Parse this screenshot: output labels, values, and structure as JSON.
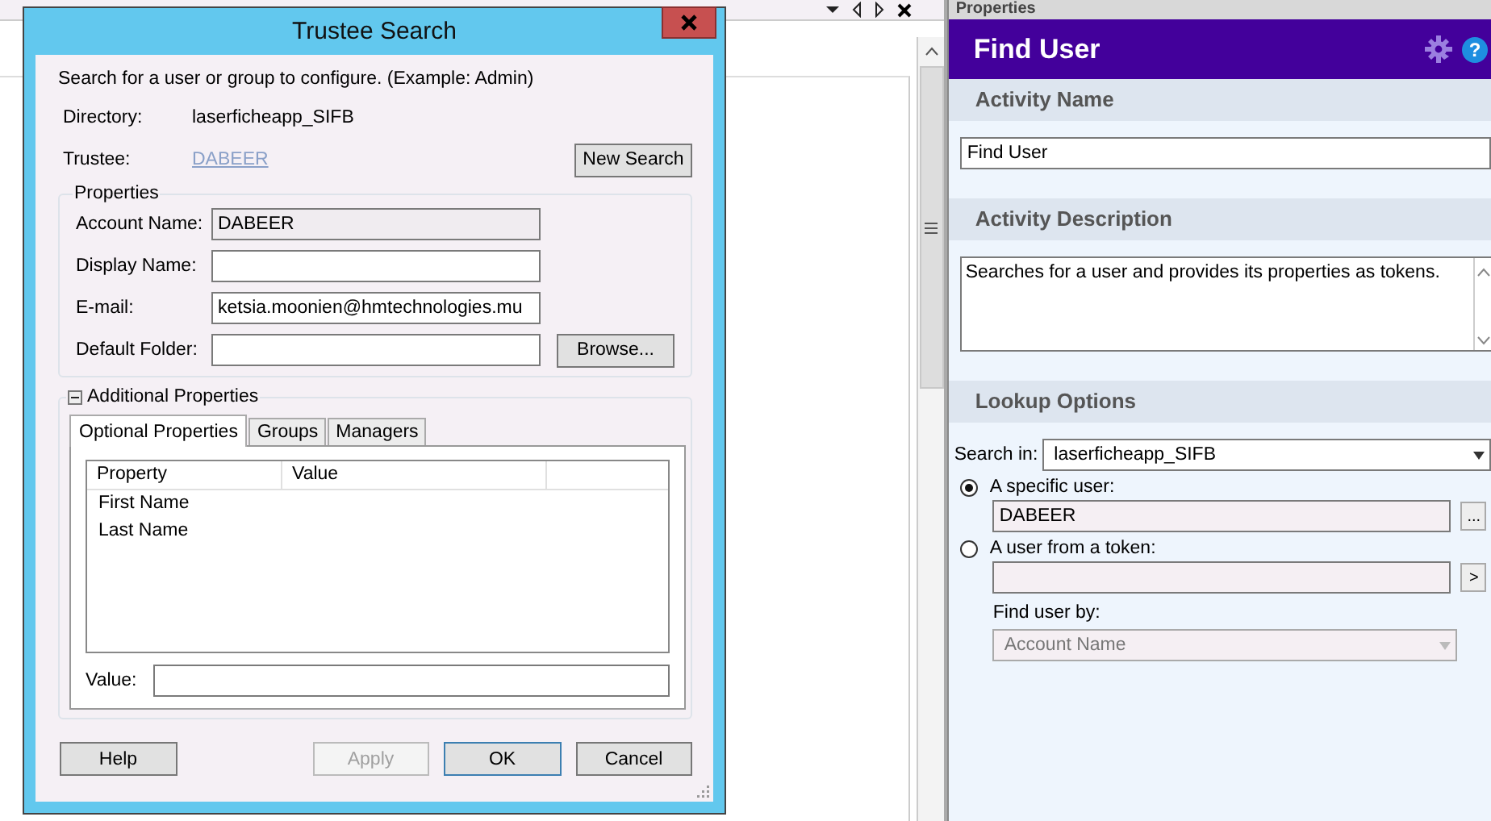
{
  "background": {
    "panel_title": "Properties"
  },
  "dialog": {
    "title": "Trustee Search",
    "instructions": "Search for a user or group to configure. (Example: Admin)",
    "directory": {
      "label": "Directory:",
      "value": "laserficheapp_SIFB"
    },
    "trustee": {
      "label": "Trustee:",
      "value": "DABEER"
    },
    "new_search_button": "New Search",
    "properties": {
      "title": "Properties",
      "fields": [
        {
          "label": "Account Name:",
          "value": "DABEER",
          "readonly": true
        },
        {
          "label": "Display Name:",
          "readonly": false
        },
        {
          "label": "E-mail:",
          "value": "ketsia.moonien@hmtechnologies.mu",
          "readonly": false
        },
        {
          "label": "Default Folder:",
          "readonly": false,
          "button": "Browse..."
        }
      ]
    },
    "additional": {
      "title": "Additional Properties",
      "expanded": true,
      "tabs": [
        {
          "label": "Optional Properties",
          "selected": true
        },
        {
          "label": "Groups",
          "selected": false
        },
        {
          "label": "Managers",
          "selected": false
        }
      ],
      "columns": [
        "Property",
        "Value"
      ],
      "rows": [
        {
          "property": "First Name"
        },
        {
          "property": "Last Name"
        }
      ],
      "value_label": "Value:"
    },
    "buttons": [
      {
        "label": "Help",
        "disabled": false,
        "default": false
      },
      {
        "label": "Apply",
        "disabled": true,
        "default": false
      },
      {
        "label": "OK",
        "disabled": false,
        "default": true
      },
      {
        "label": "Cancel",
        "disabled": false,
        "default": false
      }
    ]
  },
  "panel": {
    "title": "Find User",
    "help_icon": "?",
    "activity_name": {
      "header": "Activity Name",
      "value": "Find User"
    },
    "activity_description": {
      "header": "Activity Description",
      "value": "Searches for a user and provides its properties as tokens."
    },
    "lookup": {
      "header": "Lookup Options",
      "search_in_label": "Search in:",
      "search_in_value": "laserficheapp_SIFB",
      "options": [
        {
          "label": "A specific user:",
          "selected": true,
          "value": "DABEER",
          "button": "..."
        },
        {
          "label": "A user from a token:",
          "selected": false,
          "button": ">"
        }
      ],
      "find_by_label": "Find user by:",
      "find_by_value": "Account Name"
    }
  }
}
